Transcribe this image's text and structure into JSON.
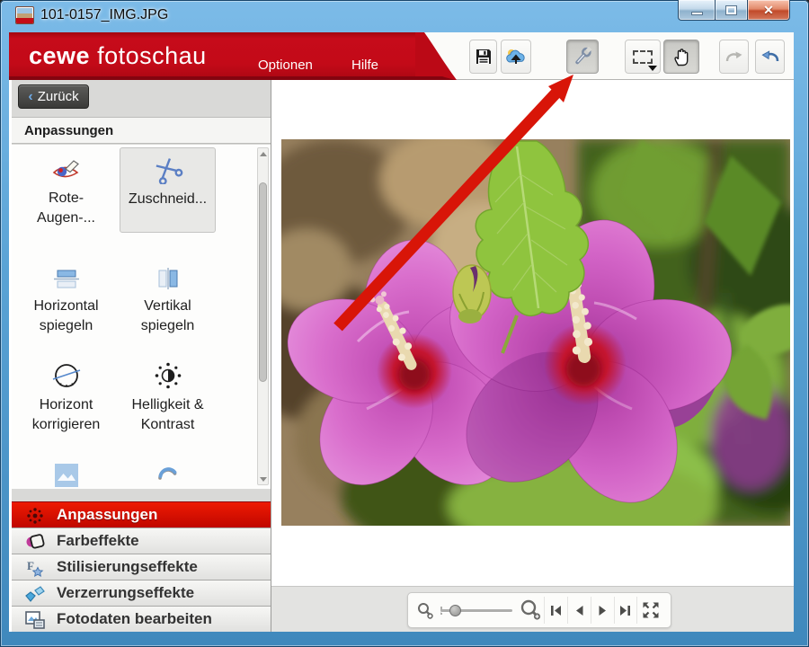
{
  "window": {
    "title": "101-0157_IMG.JPG"
  },
  "header": {
    "brand_bold": "cewe",
    "brand_light": "fotoschau",
    "menus": [
      {
        "label": "Optionen"
      },
      {
        "label": "Hilfe"
      }
    ]
  },
  "toolbar": {
    "buttons": [
      {
        "name": "save",
        "icon": "floppy-disk-icon",
        "state": "normal"
      },
      {
        "name": "upload",
        "icon": "cloud-upload-icon",
        "state": "normal"
      },
      {
        "name": "tools",
        "icon": "wrench-icon",
        "state": "active"
      },
      {
        "name": "selection",
        "icon": "selection-rectangle-icon",
        "state": "normal",
        "has_dropdown": true
      },
      {
        "name": "pan",
        "icon": "hand-icon",
        "state": "active"
      },
      {
        "name": "redo",
        "icon": "redo-arrow-icon",
        "state": "disabled"
      },
      {
        "name": "undo",
        "icon": "undo-arrow-icon",
        "state": "normal"
      }
    ]
  },
  "sidebar": {
    "back_label": "Zurück",
    "panel_title": "Anpassungen",
    "tools": [
      {
        "label": "Rote-\nAugen-...",
        "icon": "red-eye-removal-icon",
        "selected": false
      },
      {
        "label": "Zuschneid...",
        "icon": "crop-scissors-icon",
        "selected": true
      },
      {
        "label": "Horizontal\nspiegeln",
        "icon": "flip-horizontal-icon",
        "selected": false
      },
      {
        "label": "Vertikal\nspiegeln",
        "icon": "flip-vertical-icon",
        "selected": false
      },
      {
        "label": "Horizont\nkorrigieren",
        "icon": "horizon-level-icon",
        "selected": false
      },
      {
        "label": "Helligkeit &\nKontrast",
        "icon": "brightness-contrast-icon",
        "selected": false
      },
      {
        "label": "",
        "icon": "image-icon",
        "selected": false
      },
      {
        "label": "",
        "icon": "rotate-swirl-icon",
        "selected": false
      }
    ],
    "categories": [
      {
        "label": "Anpassungen",
        "icon": "sparkle-adjust-icon",
        "active": true
      },
      {
        "label": "Farbeffekte",
        "icon": "color-palette-icon",
        "active": false
      },
      {
        "label": "Stilisierungseffekte",
        "icon": "stylize-star-icon",
        "active": false
      },
      {
        "label": "Verzerrungseffekte",
        "icon": "distortion-gems-icon",
        "active": false
      },
      {
        "label": "Fotodaten bearbeiten",
        "icon": "photo-edit-icon",
        "active": false
      }
    ]
  },
  "viewer": {
    "zoom_slider_percent": 12
  },
  "annotation": {
    "type": "red-arrow",
    "points_to": "wrench-tools-button",
    "color": "#d81508"
  },
  "colors": {
    "brand_red": "#c30a18",
    "active_category_red": "#dd1000",
    "titlebar_blue": "#5ba4d6"
  }
}
